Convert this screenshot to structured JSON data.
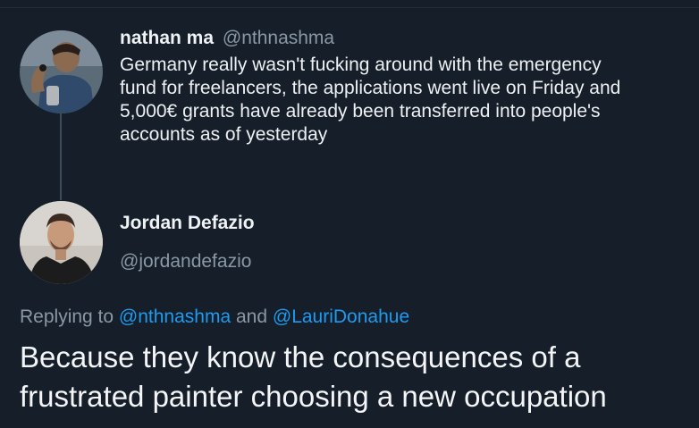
{
  "tweet": {
    "author_name": "nathan ma",
    "author_handle": "@nthnashma",
    "text_lines": [
      "Germany really wasn't fucking around with the emergency",
      "fund for freelancers, the applications went live on Friday and",
      "5,000€ grants have already been transferred into people's",
      "accounts as of yesterday"
    ]
  },
  "reply": {
    "author_name": "Jordan Defazio",
    "author_handle": "@jordandefazio",
    "replying_prefix": "Replying to",
    "mention_1": "@nthnashma",
    "connector": "and",
    "mention_2": "@LauriDonahue",
    "text_lines": [
      "Because they know the consequences of a",
      "frustrated painter choosing a new occupation"
    ]
  },
  "colors": {
    "background": "#151e29",
    "text": "#eef1f3",
    "secondary_text": "#8a98a6",
    "mention": "#1d9bf0",
    "thread_line": "#3d4a58"
  },
  "icons": {
    "nathan_avatar": "profile-photo",
    "jordan_avatar": "profile-photo"
  }
}
